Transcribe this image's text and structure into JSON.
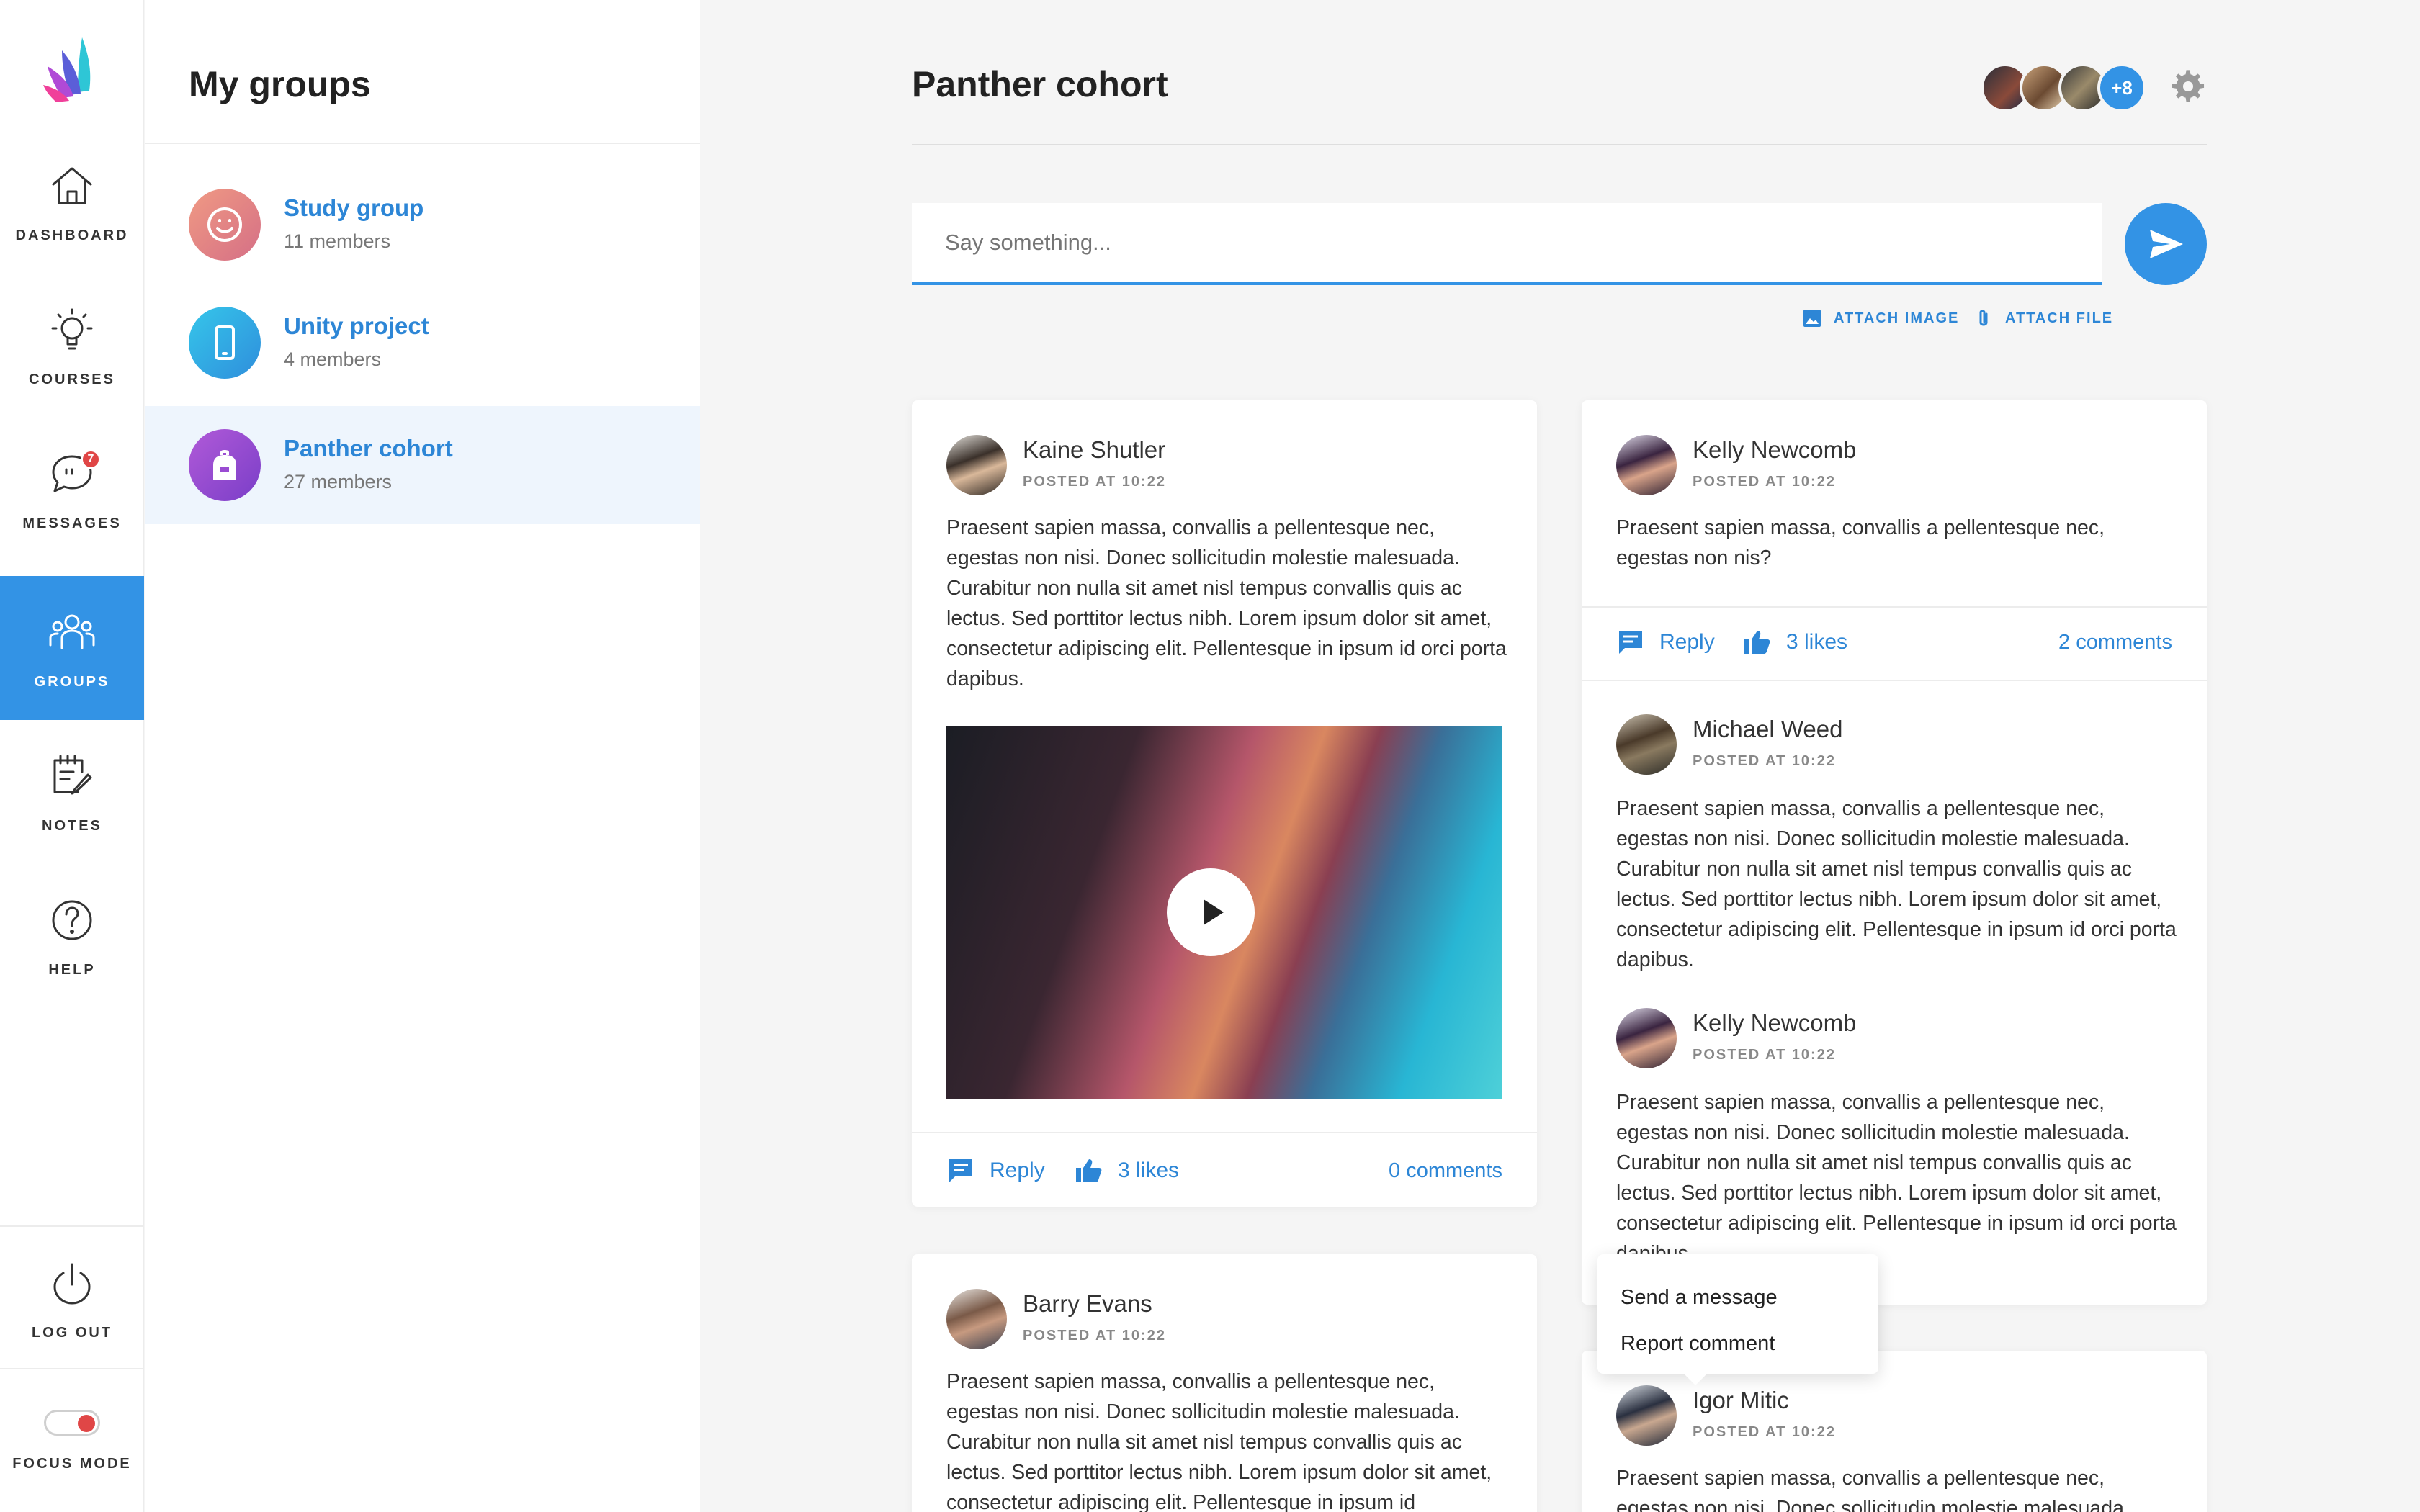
{
  "nav": {
    "items": [
      {
        "label": "DASHBOARD",
        "icon": "home-icon"
      },
      {
        "label": "COURSES",
        "icon": "lightbulb-icon"
      },
      {
        "label": "MESSAGES",
        "icon": "chat-icon",
        "badge": "7"
      },
      {
        "label": "GROUPS",
        "icon": "users-icon",
        "active": true
      },
      {
        "label": "NOTES",
        "icon": "notepad-icon"
      },
      {
        "label": "HELP",
        "icon": "help-icon"
      }
    ],
    "logout_label": "LOG OUT",
    "focus_label": "FOCUS MODE"
  },
  "groups": {
    "title": "My groups",
    "items": [
      {
        "name": "Study group",
        "members": "11 members"
      },
      {
        "name": "Unity project",
        "members": "4 members"
      },
      {
        "name": "Panther cohort",
        "members": "27 members",
        "active": true
      }
    ]
  },
  "main": {
    "title": "Panther cohort",
    "more_members": "+8",
    "compose_placeholder": "Say something...",
    "attach_image": "ATTACH IMAGE",
    "attach_file": "ATTACH FILE"
  },
  "posts": {
    "kaine": {
      "author": "Kaine Shutler",
      "posted": "POSTED AT 10:22",
      "text": "Praesent sapien massa, convallis a pellentesque nec, egestas non nisi. Donec sollicitudin molestie malesuada. Curabitur non nulla sit amet nisl tempus convallis quis ac lectus. Sed porttitor lectus nibh. Lorem ipsum dolor sit amet, consectetur adipiscing elit. Pellentesque in ipsum id orci porta dapibus.",
      "reply": "Reply",
      "likes": "3 likes",
      "comments": "0 comments"
    },
    "barry": {
      "author": "Barry Evans",
      "posted": "POSTED AT 10:22",
      "text": "Praesent sapien massa, convallis a pellentesque nec, egestas non nisi. Donec sollicitudin molestie malesuada. Curabitur non nulla sit amet nisl tempus convallis quis ac lectus. Sed porttitor lectus nibh. Lorem ipsum dolor sit amet, consectetur adipiscing elit. Pellentesque in ipsum id"
    },
    "kelly": {
      "author": "Kelly Newcomb",
      "posted": "POSTED AT 10:22",
      "text": "Praesent sapien massa, convallis a pellentesque nec, egestas non nis?",
      "reply": "Reply",
      "likes": "3 likes",
      "comments": "2 comments"
    },
    "michael": {
      "author": "Michael Weed",
      "posted": "POSTED AT 10:22",
      "text": "Praesent sapien massa, convallis a pellentesque nec, egestas non nisi. Donec sollicitudin molestie malesuada. Curabitur non nulla sit amet nisl tempus convallis quis ac lectus. Sed porttitor lectus nibh. Lorem ipsum dolor sit amet, consectetur adipiscing elit. Pellentesque in ipsum id orci porta dapibus."
    },
    "kelly2": {
      "author": "Kelly Newcomb",
      "posted": "POSTED AT 10:22",
      "text": "Praesent sapien massa, convallis a pellentesque nec, egestas non nisi. Donec sollicitudin molestie malesuada. Curabitur non nulla sit amet nisl tempus convallis quis ac lectus. Sed porttitor lectus nibh. Lorem ipsum dolor sit amet, consectetur adipiscing elit. Pellentesque in ipsum id orci porta dapibus."
    },
    "igor": {
      "author": "Igor Mitic",
      "posted": "POSTED AT 10:22",
      "text": "Praesent sapien massa, convallis a pellentesque nec, egestas non nisi. Donec sollicitudin molestie malesuada."
    }
  },
  "popover": {
    "send_message": "Send a message",
    "report_comment": "Report comment"
  },
  "colors": {
    "accent": "#3393e5",
    "link": "#2d86d6",
    "badge": "#e04646"
  }
}
